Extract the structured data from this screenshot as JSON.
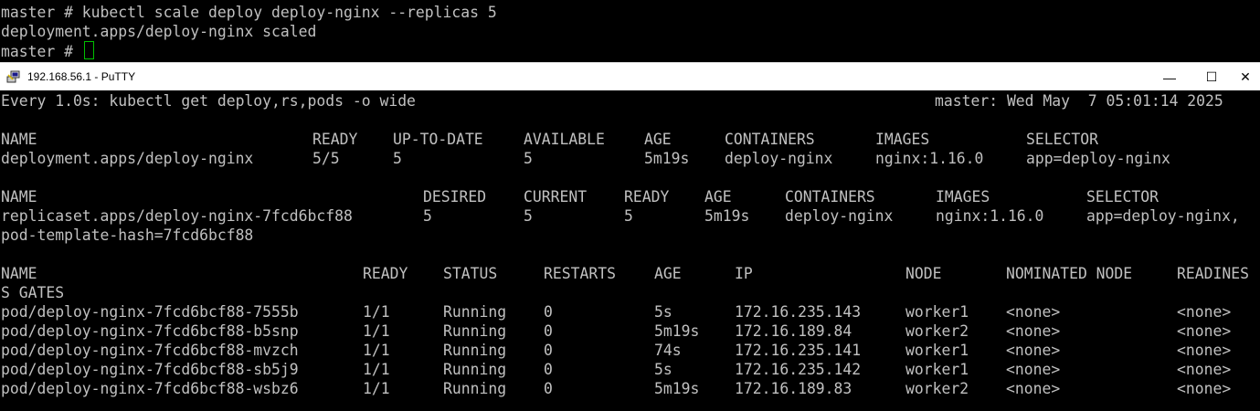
{
  "background_terminal": {
    "partial_top_line": "",
    "line1": "master # kubectl scale deploy deploy-nginx --replicas 5",
    "line2": "deployment.apps/deploy-nginx scaled",
    "prompt": "master # "
  },
  "window": {
    "title": "192.168.56.1 - PuTTY",
    "minimize": "—",
    "maximize": "☐",
    "close": "✕"
  },
  "watch_header": {
    "command": "Every 1.0s: kubectl get deploy,rs,pods -o wide",
    "host_time": "master: Wed May  7 05:01:14 2025"
  },
  "deploy": {
    "headers": [
      "NAME",
      "READY",
      "UP-TO-DATE",
      "AVAILABLE",
      "AGE",
      "CONTAINERS",
      "IMAGES",
      "SELECTOR"
    ],
    "row": [
      "deployment.apps/deploy-nginx",
      "5/5",
      "5",
      "5",
      "5m19s",
      "deploy-nginx",
      "nginx:1.16.0",
      "app=deploy-nginx"
    ]
  },
  "rs": {
    "headers": [
      "NAME",
      "DESIRED",
      "CURRENT",
      "READY",
      "AGE",
      "CONTAINERS",
      "IMAGES",
      "SELECTOR"
    ],
    "row": [
      "replicaset.apps/deploy-nginx-7fcd6bcf88",
      "5",
      "5",
      "5",
      "5m19s",
      "deploy-nginx",
      "nginx:1.16.0",
      "app=deploy-nginx,"
    ],
    "wrap": "pod-template-hash=7fcd6bcf88"
  },
  "pods": {
    "headers": [
      "NAME",
      "READY",
      "STATUS",
      "RESTARTS",
      "AGE",
      "IP",
      "NODE",
      "NOMINATED NODE",
      "READINES"
    ],
    "wrap_header": "S GATES",
    "rows": [
      [
        "pod/deploy-nginx-7fcd6bcf88-7555b",
        "1/1",
        "Running",
        "0",
        "5s",
        "172.16.235.143",
        "worker1",
        "<none>",
        "<none>"
      ],
      [
        "pod/deploy-nginx-7fcd6bcf88-b5snp",
        "1/1",
        "Running",
        "0",
        "5m19s",
        "172.16.189.84",
        "worker2",
        "<none>",
        "<none>"
      ],
      [
        "pod/deploy-nginx-7fcd6bcf88-mvzch",
        "1/1",
        "Running",
        "0",
        "74s",
        "172.16.235.141",
        "worker1",
        "<none>",
        "<none>"
      ],
      [
        "pod/deploy-nginx-7fcd6bcf88-sb5j9",
        "1/1",
        "Running",
        "0",
        "5s",
        "172.16.235.142",
        "worker1",
        "<none>",
        "<none>"
      ],
      [
        "pod/deploy-nginx-7fcd6bcf88-wsbz6",
        "1/1",
        "Running",
        "0",
        "5m19s",
        "172.16.189.83",
        "worker2",
        "<none>",
        "<none>"
      ]
    ]
  }
}
